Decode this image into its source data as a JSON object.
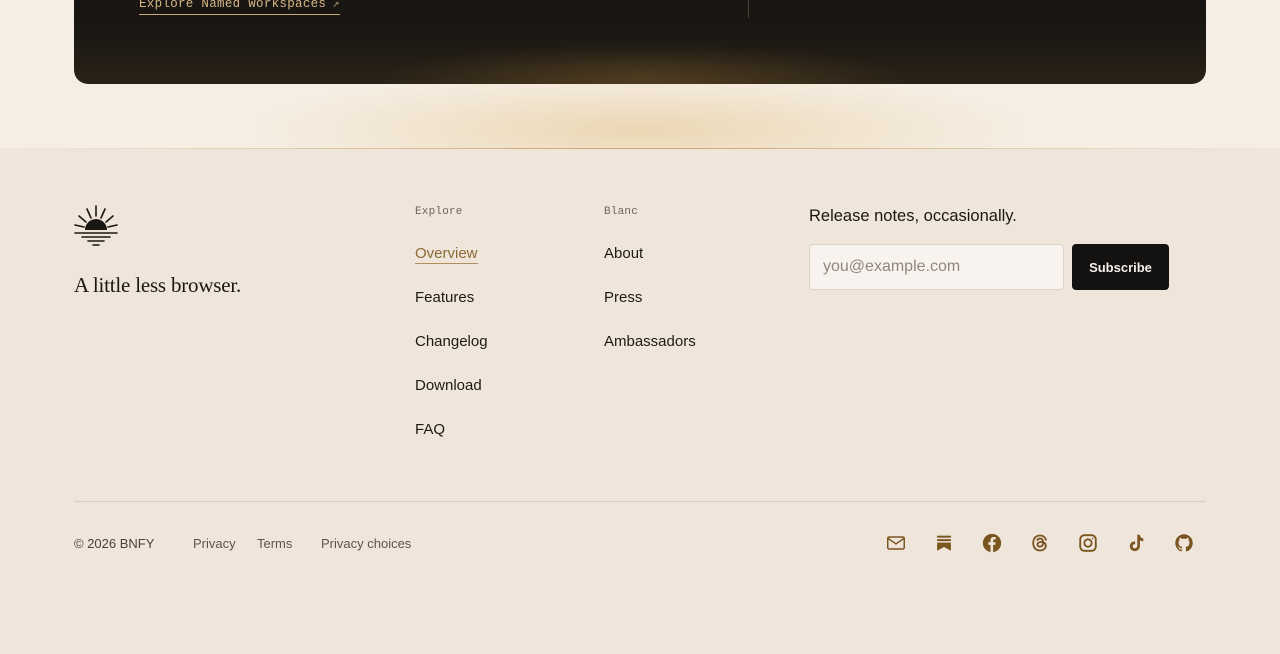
{
  "promo": {
    "explore_link": "Explore Named Workspaces",
    "explore_arrow": "↗"
  },
  "brand": {
    "logo": "sunrise-logo",
    "tagline": "A little less browser."
  },
  "nav": {
    "explore": {
      "heading": "Explore",
      "items": [
        "Overview",
        "Features",
        "Changelog",
        "Download",
        "FAQ"
      ],
      "active": "Overview"
    },
    "blanc": {
      "heading": "Blanc",
      "items": [
        "About",
        "Press",
        "Ambassadors"
      ]
    }
  },
  "newsletter": {
    "title": "Release notes, occasionally.",
    "placeholder": "you@example.com",
    "button": "Subscribe"
  },
  "footer": {
    "copyright": "© 2026 BNFY",
    "links": [
      "Privacy",
      "Terms",
      "Privacy choices"
    ],
    "socials": [
      "mail-icon",
      "substack-icon",
      "facebook-icon",
      "threads-icon",
      "instagram-icon",
      "tiktok-icon",
      "github-icon"
    ]
  },
  "colors": {
    "background": "#efe5da",
    "dark_card": "#141210",
    "accent": "#8a6a35",
    "icon": "#7a5520",
    "button": "#141210"
  }
}
